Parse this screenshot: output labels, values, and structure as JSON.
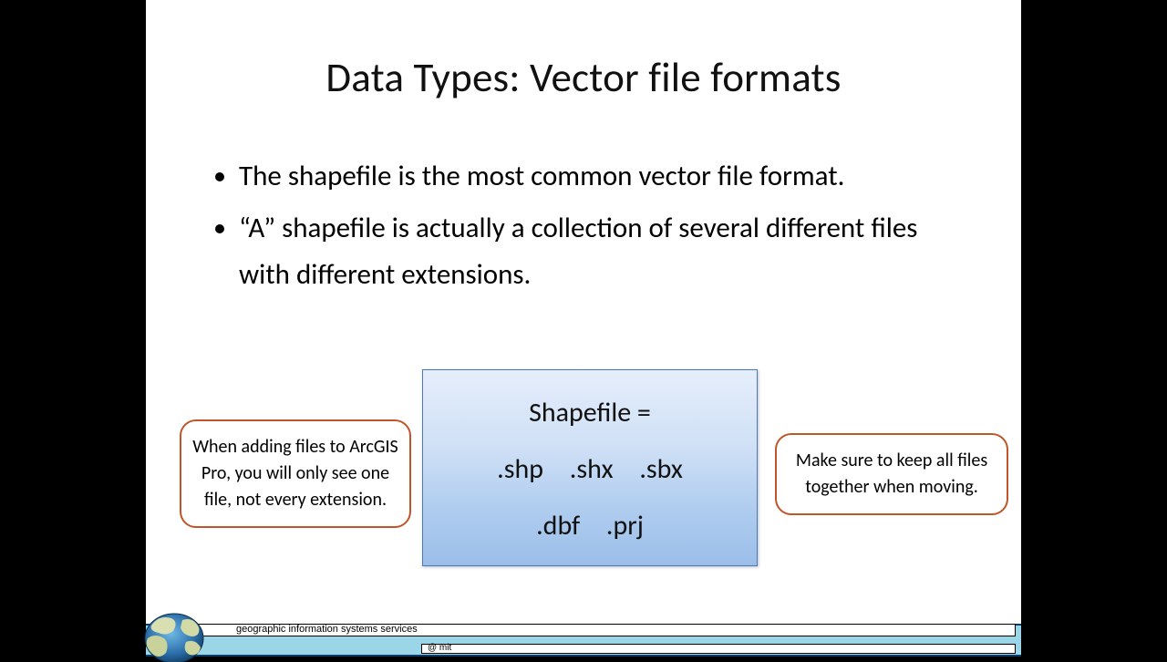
{
  "title": "Data Types: Vector file formats",
  "bullets": [
    "The shapefile is the most common vector file format.",
    "“A” shapefile is actually a collection of several different files with different extensions."
  ],
  "callout_left": "When adding files to ArcGIS Pro, you will only see one file, not every extension.",
  "callout_right": "Make sure to keep all files together when moving.",
  "center": {
    "heading": "Shapefile =",
    "row1": ".shp .shx .sbx",
    "row2": ".dbf .prj"
  },
  "footer": {
    "org": "geographic information systems services",
    "at": "@ mit"
  }
}
